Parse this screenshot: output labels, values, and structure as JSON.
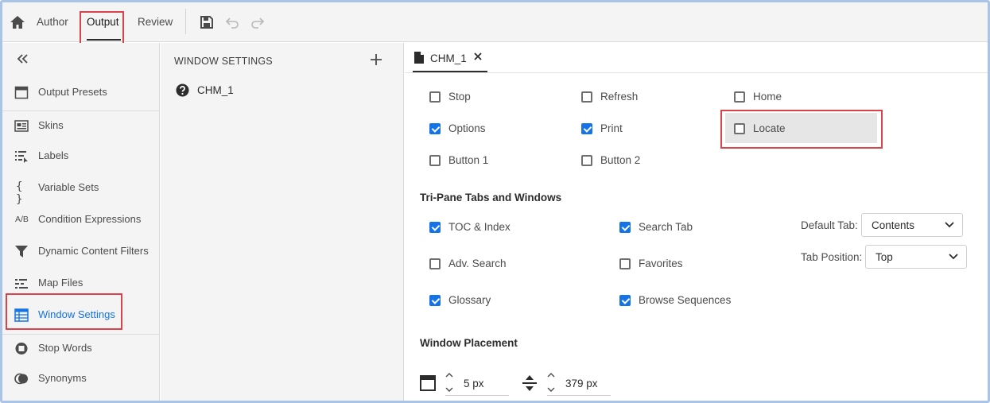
{
  "topbar": {
    "tabs": [
      "Author",
      "Output",
      "Review"
    ],
    "active_tab": "Output",
    "icons": [
      "home-icon",
      "save-icon",
      "undo-icon",
      "redo-icon"
    ]
  },
  "sidebar": {
    "collapse_icon": "double-chevron-left-icon",
    "items": [
      {
        "label": "Output Presets",
        "icon": "output-presets-icon"
      },
      {
        "label": "Skins",
        "icon": "skins-icon"
      },
      {
        "label": "Labels",
        "icon": "labels-icon"
      },
      {
        "label": "Variable Sets",
        "icon": "braces-icon"
      },
      {
        "label": "Condition Expressions",
        "icon": "ab-icon",
        "icon_text": "A/B"
      },
      {
        "label": "Dynamic Content Filters",
        "icon": "filter-icon"
      },
      {
        "label": "Map Files",
        "icon": "map-files-icon"
      },
      {
        "label": "Window Settings",
        "icon": "window-settings-icon",
        "active": true
      },
      {
        "label": "Stop Words",
        "icon": "stop-words-icon"
      },
      {
        "label": "Synonyms",
        "icon": "synonyms-icon"
      }
    ]
  },
  "middle": {
    "title": "WINDOW SETTINGS",
    "add_icon": "plus-icon",
    "items": [
      {
        "label": "CHM_1",
        "icon": "help-circle-icon"
      }
    ]
  },
  "right": {
    "tab": {
      "label": "CHM_1",
      "icon": "document-icon",
      "close_icon": "close-icon"
    },
    "buttons": [
      {
        "label": "Stop",
        "checked": false
      },
      {
        "label": "Refresh",
        "checked": false
      },
      {
        "label": "Home",
        "checked": false
      },
      {
        "label": "Options",
        "checked": true
      },
      {
        "label": "Print",
        "checked": true
      },
      {
        "label": "Locate",
        "checked": false
      },
      {
        "label": "Button 1",
        "checked": false
      },
      {
        "label": "Button 2",
        "checked": false
      }
    ],
    "tri_pane": {
      "title": "Tri-Pane Tabs and Windows",
      "options": [
        {
          "label": "TOC & Index",
          "checked": true
        },
        {
          "label": "Search Tab",
          "checked": true
        },
        {
          "label": "Adv. Search",
          "checked": false
        },
        {
          "label": "Favorites",
          "checked": false
        },
        {
          "label": "Glossary",
          "checked": true
        },
        {
          "label": "Browse Sequences",
          "checked": true
        }
      ],
      "default_tab_label": "Default Tab:",
      "default_tab_value": "Contents",
      "tab_position_label": "Tab Position:",
      "tab_position_value": "Top"
    },
    "placement": {
      "title": "Window Placement",
      "left_value": "5 px",
      "top_value": "379 px",
      "icons": [
        "window-position-icon",
        "vertical-resize-icon"
      ]
    }
  },
  "colors": {
    "accent": "#1473e6",
    "highlight": "#d9444b",
    "panel_bg": "#f4f4f4"
  }
}
